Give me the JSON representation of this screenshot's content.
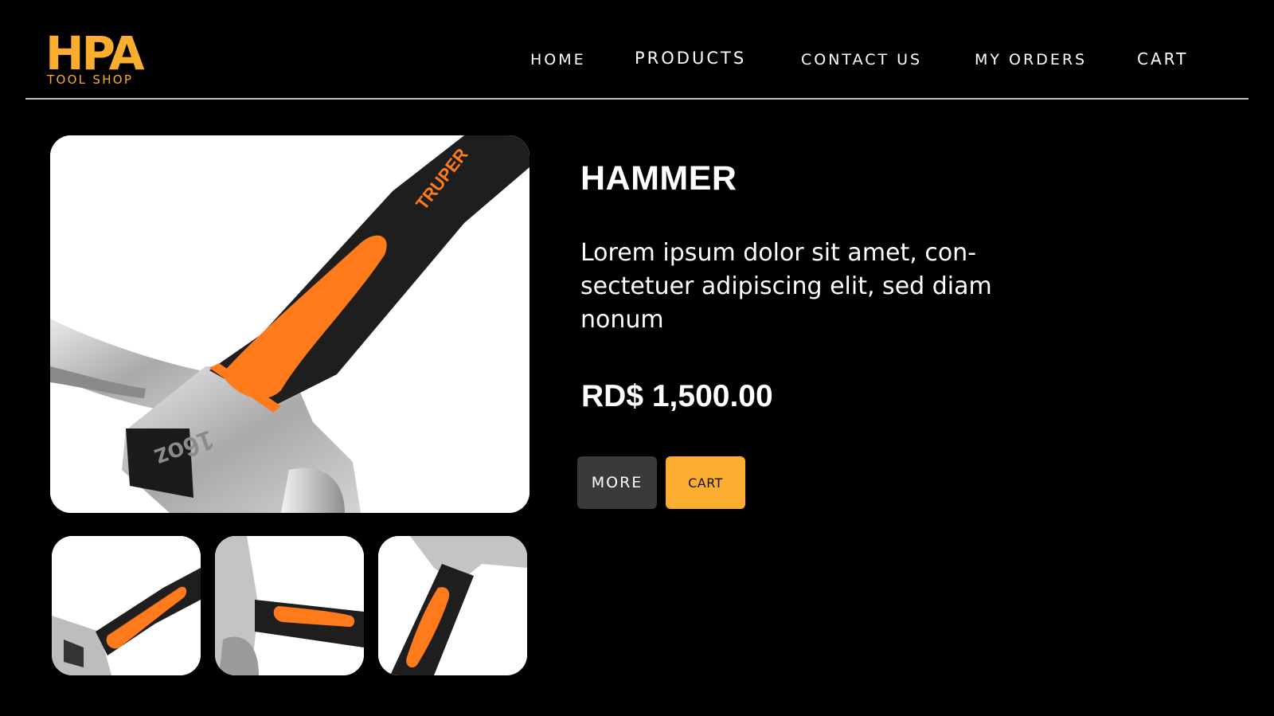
{
  "brand": {
    "mark": "HPA",
    "name": "TOOL SHOP",
    "accent_color": "#fbad30"
  },
  "nav": {
    "items": [
      {
        "label": "HOME"
      },
      {
        "label": "PRODUCTS"
      },
      {
        "label": "CONTACT US"
      },
      {
        "label": "MY ORDERS"
      },
      {
        "label": "CART"
      }
    ]
  },
  "product": {
    "name": "HAMMER",
    "description": "Lorem ipsum dolor sit amet, con-sectetuer adipiscing elit, sed diam nonum",
    "price": "RD$ 1,500.00",
    "image_brand": "TRUPER",
    "image_weight": "16oz",
    "handle_color": "#ff7a1a"
  },
  "actions": {
    "more_label": "MORE",
    "cart_label": "CART"
  },
  "colors": {
    "background": "#000000",
    "more_button": "#3a3a3a",
    "cart_button": "#fbad30"
  }
}
